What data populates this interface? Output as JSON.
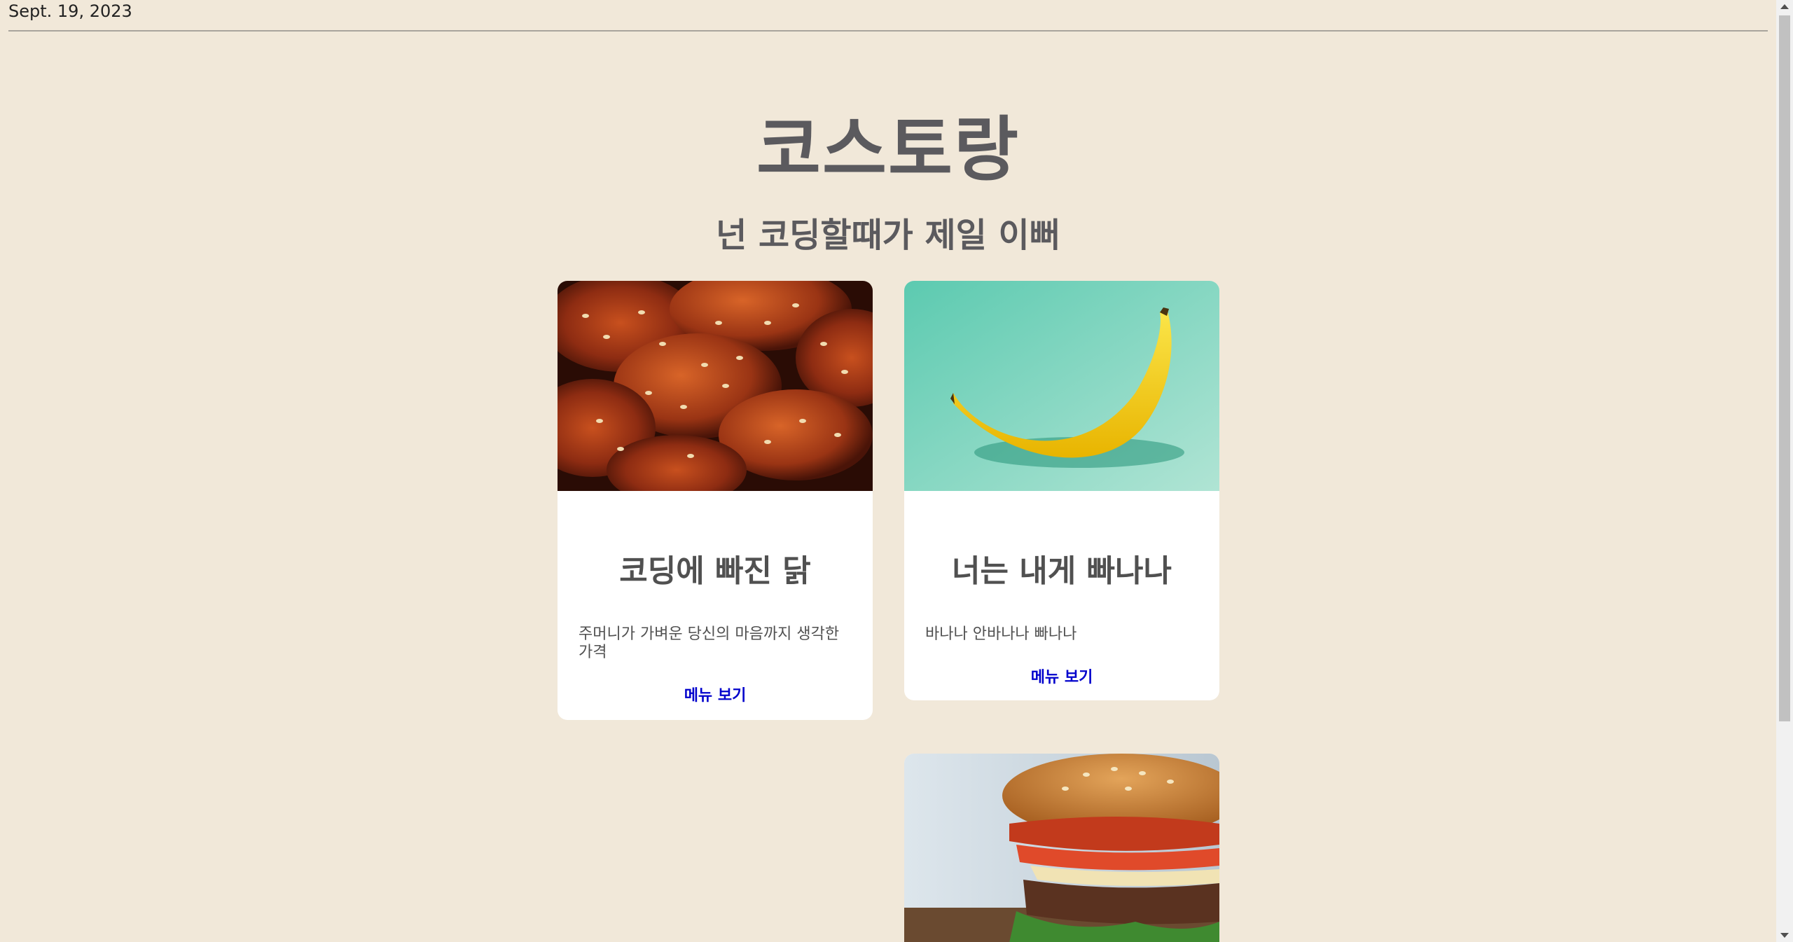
{
  "header": {
    "date": "Sept. 19, 2023"
  },
  "site": {
    "title": "코스토랑",
    "subtitle": "넌 코딩할때가 제일 이뻐"
  },
  "cards": [
    {
      "title": "코딩에 빠진 닭",
      "description": "주머니가 가벼운 당신의 마음까지 생각한 가격",
      "link": "메뉴 보기",
      "image": "fried-chicken-image"
    },
    {
      "title": "너는 내게 빠나나",
      "description": "바나나 안바나나 빠나나",
      "link": "메뉴 보기",
      "image": "banana-image"
    },
    {
      "image": "burger-image"
    }
  ],
  "colors": {
    "background": "#f1e8d9",
    "card": "#ffffff",
    "heading": "#5b5a5e",
    "link": "#0000cc"
  }
}
